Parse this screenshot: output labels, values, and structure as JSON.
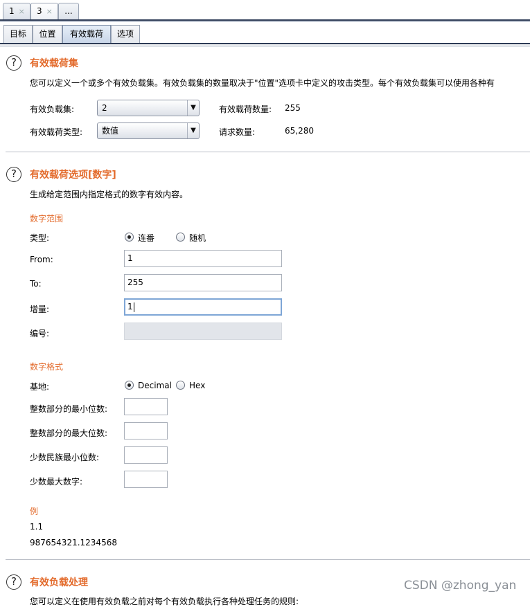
{
  "request_tabs": [
    {
      "label": "1",
      "close": "×"
    },
    {
      "label": "3",
      "close": "×"
    },
    {
      "label": "..."
    }
  ],
  "sub_tabs": [
    "目标",
    "位置",
    "有效载荷",
    "选项"
  ],
  "payload_sets": {
    "title": "有效载荷集",
    "description": "您可以定义一个或多个有效负载集。有效负载集的数量取决于\"位置\"选项卡中定义的攻击类型。每个有效负载集可以使用各种有",
    "set_label": "有效负载集:",
    "set_value": "2",
    "count_label": "有效载荷数量:",
    "count_value": "255",
    "type_label": "有效载荷类型:",
    "type_value": "数值",
    "requests_label": "请求数量:",
    "requests_value": "65,280"
  },
  "payload_options": {
    "title": "有效载荷选项[数字]",
    "description": "生成给定范围内指定格式的数字有效内容。",
    "range_title": "数字范围",
    "type_label": "类型:",
    "type_sequential": "连番",
    "type_random": "随机",
    "from_label": "From:",
    "from_value": "1",
    "to_label": "To:",
    "to_value": "255",
    "step_label": "增量:",
    "step_value": "1",
    "howmany_label": "编号:",
    "howmany_value": "",
    "format_title": "数字格式",
    "base_label": "基地:",
    "base_decimal": "Decimal",
    "base_hex": "Hex",
    "min_int_label": "整数部分的最小位数:",
    "max_int_label": "整数部分的最大位数:",
    "min_frac_label": "少数民族最小位数:",
    "max_frac_label": "少数最大数字:",
    "example_title": "例",
    "example_1": "1.1",
    "example_2": "987654321.1234568"
  },
  "payload_processing": {
    "title": "有效负载处理",
    "description": "您可以定义在使用有效负载之前对每个有效负载执行各种处理任务的规则:"
  },
  "watermark": "CSDN @zhong_yan",
  "colors": {
    "accent": "#e36b2c",
    "tab_active": "#c9d6e8"
  }
}
